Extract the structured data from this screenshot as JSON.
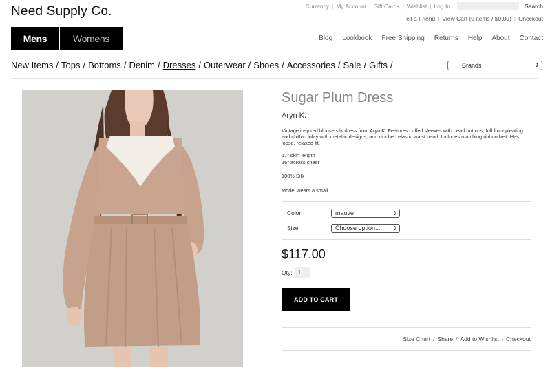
{
  "site": {
    "logo": "Need Supply Co."
  },
  "utility_nav": {
    "items": [
      "Currency",
      "My Account",
      "Gift Cards",
      "Wishlist",
      "Log In"
    ],
    "search_placeholder": "",
    "search_label": "Search"
  },
  "cart_nav": {
    "items": [
      "Tell a Friend",
      "View Cart (0 items / $0.00)",
      "Checkout"
    ]
  },
  "gender_tabs": [
    "Mens",
    "Womens"
  ],
  "main_nav": [
    "Blog",
    "Lookbook",
    "Free Shipping",
    "Returns",
    "Help",
    "About",
    "Contact"
  ],
  "categories": [
    "New Items",
    "Tops",
    "Bottoms",
    "Denim",
    "Dresses",
    "Outerwear",
    "Shoes",
    "Accessories",
    "Sale",
    "Gifts"
  ],
  "category_separator": "/",
  "active_category": "Dresses",
  "brands_select": {
    "value": "Brands",
    "arrow": "⇕"
  },
  "product": {
    "title": "Sugar Plum Dress",
    "brand": "Aryn K.",
    "description": "Vintage inspired blouse silk dress from Aryn K. Features cuffed sleeves with pearl buttons, full front pleating and chiffon inlay with metallic designs, and cinched elastic waist band. Includes matching ribbon belt. Has loose, relaxed fit.",
    "specs": [
      "17\" skirt length",
      "16\" across chest"
    ],
    "material": "100% Silk",
    "model_note": "Model wears a small.",
    "options": [
      {
        "label": "Color",
        "value": "mauve"
      },
      {
        "label": "Size",
        "value": "Choose option..."
      }
    ],
    "price": "$117.00",
    "qty_label": "Qty:",
    "qty_value": "1",
    "add_to_cart": "ADD TO CART"
  },
  "bottom_links": [
    "Size Chart",
    "Share",
    "Add to Wishlist",
    "Checkout"
  ],
  "colors": {
    "accent": "#000000",
    "dress": "#c9a48e",
    "lace": "#f2ede6"
  }
}
